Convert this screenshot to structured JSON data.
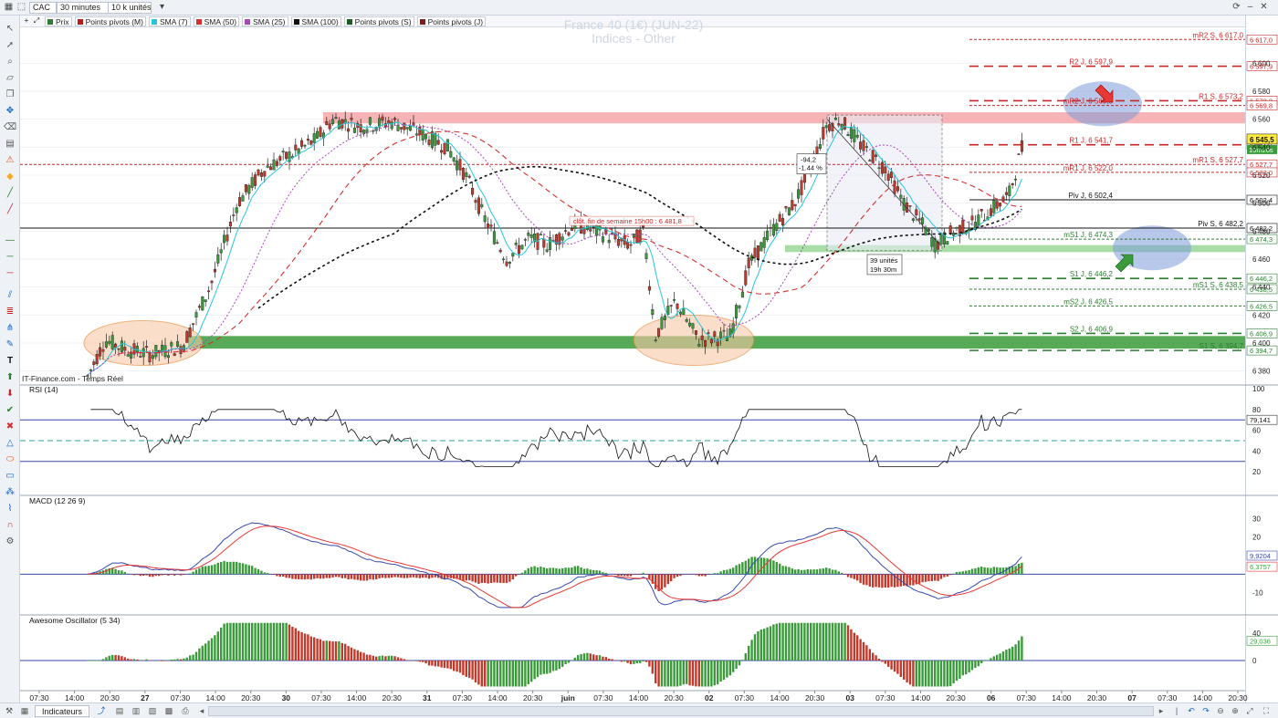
{
  "toolbar": {
    "instrument": "CAC",
    "interval": "30 minutes",
    "units": "10 k unités"
  },
  "legend": [
    {
      "label": "Prix",
      "color": "#2e7d32"
    },
    {
      "label": "Points pivots (M)",
      "color": "#b71c1c"
    },
    {
      "label": "SMA (7)",
      "color": "#26c6da"
    },
    {
      "label": "SMA (50)",
      "color": "#d32f2f"
    },
    {
      "label": "SMA (25)",
      "color": "#ab47bc"
    },
    {
      "label": "SMA (100)",
      "color": "#111111"
    },
    {
      "label": "Points pivots (S)",
      "color": "#1b5e20"
    },
    {
      "label": "Points pivots (J)",
      "color": "#7b1f1f"
    }
  ],
  "chart_title": "France 40 (1€) (JUN-22)",
  "chart_subtitle": "Indices - Other",
  "source_note": "IT-Finance.com - Temps Réel",
  "colors": {
    "up": "#3a9b3a",
    "down": "#c0392b",
    "resistance": "#d32f2f",
    "support": "#2e7d32",
    "sma7": "#26c6da",
    "sma25": "#ab47bc",
    "sma50": "#d32f2f",
    "sma100": "#111111",
    "rsi": "#111111",
    "macd": "#3949ab",
    "signal": "#e53935",
    "bands": "#3949ab"
  },
  "chart_data": [
    {
      "type": "candlestick",
      "name": "Prix",
      "ylim": [
        6370,
        6625
      ],
      "y_ticks": [
        6380,
        6400,
        6420,
        6440,
        6460,
        6480,
        6500,
        6520,
        6540,
        6560,
        6580,
        6600
      ],
      "last_price": "6 545,5",
      "countdown": "15m20s",
      "pivots": [
        {
          "label": "mR2 S, 6 617,0",
          "axis_label": "6 617,0",
          "value": 6617.0,
          "style": "resistance-dotted"
        },
        {
          "label": "R2 J, 6 597,9",
          "axis_label": "6 597,9",
          "value": 6597.9,
          "style": "resistance-dashed"
        },
        {
          "label": "R1 S, 6 573,2",
          "axis_label": "6 573,2",
          "value": 6573.2,
          "style": "resistance-dashed"
        },
        {
          "label": "mR2 J, 6 569,8",
          "axis_label": "6 569,8",
          "value": 6569.8,
          "style": "resistance-dotted"
        },
        {
          "label": "R1 J, 6 541,7",
          "axis_label": "6 541,7",
          "value": 6541.7,
          "style": "resistance-dashed"
        },
        {
          "label": "mR1 S, 6 527,7",
          "axis_label": "6 527,7",
          "value": 6527.7,
          "style": "resistance-dotted"
        },
        {
          "label": "mR1 J, 6 522,0",
          "axis_label": "6 522,0",
          "value": 6522.0,
          "style": "resistance-dotted"
        },
        {
          "label": "Piv J, 6 502,4",
          "axis_label": "6 502,4",
          "value": 6502.4,
          "style": "pivot"
        },
        {
          "label": "Piv S, 6 482,2",
          "axis_label": "6 482,2",
          "value": 6482.2,
          "style": "pivot"
        },
        {
          "label": "mS1 J, 6 474,3",
          "axis_label": "6 474,3",
          "value": 6474.3,
          "style": "support-dotted"
        },
        {
          "label": "S1 J, 6 446,2",
          "axis_label": "6 446,2",
          "value": 6446.2,
          "style": "support-dashed"
        },
        {
          "label": "mS1 S, 6 438,5",
          "axis_label": "6 438,5",
          "value": 6438.5,
          "style": "support-dotted"
        },
        {
          "label": "mS2 J, 6 426,5",
          "axis_label": "6 426,5",
          "value": 6426.5,
          "style": "support-dotted"
        },
        {
          "label": "S2 J, 6 406,9",
          "axis_label": "6 406,9",
          "value": 6406.9,
          "style": "support-dashed"
        },
        {
          "label": "S1 S, 6 394,7",
          "axis_label": "6 394,7",
          "value": 6394.7,
          "style": "support-dashed"
        }
      ],
      "annotations": {
        "close_label": "clôt. fin de semaine 15h00 : 6 481,8",
        "measure_change": "-94,2",
        "measure_pct": "-1.44 %",
        "measure_bars": "39 unités",
        "measure_time": "19h 30m"
      }
    },
    {
      "type": "line",
      "name": "RSI (14)",
      "ylim": [
        0,
        100
      ],
      "y_ticks": [
        20,
        40,
        60,
        80,
        100
      ],
      "bands": [
        30,
        70
      ],
      "mid": 50,
      "last_value": "79,141"
    },
    {
      "type": "bar+line",
      "name": "MACD (12 26 9)",
      "ylim": [
        -20,
        40
      ],
      "y_ticks": [
        -10,
        10,
        20,
        30
      ],
      "zero": 0,
      "last_macd": "9,9204",
      "last_signal": "6,3757"
    },
    {
      "type": "bar",
      "name": "Awesome Oscillator (5 34)",
      "ylim": [
        -40,
        60
      ],
      "y_ticks": [
        0,
        40
      ],
      "zero": 0,
      "last_value": "29,036"
    }
  ],
  "x_labels": [
    "07:30",
    "14:00",
    "20:30",
    "27",
    "07:30",
    "14:00",
    "20:30",
    "30",
    "07:30",
    "14:00",
    "20:30",
    "31",
    "07:30",
    "14:00",
    "20:30",
    "juin",
    "07:30",
    "14:00",
    "20:30",
    "02",
    "07:30",
    "14:00",
    "20:30",
    "03",
    "07:30",
    "14:00",
    "20:30",
    "06",
    "07:30",
    "14:00",
    "20:30",
    "07",
    "07:30",
    "14:00",
    "20:30"
  ],
  "bottom": {
    "indicators_button": "Indicateurs"
  }
}
